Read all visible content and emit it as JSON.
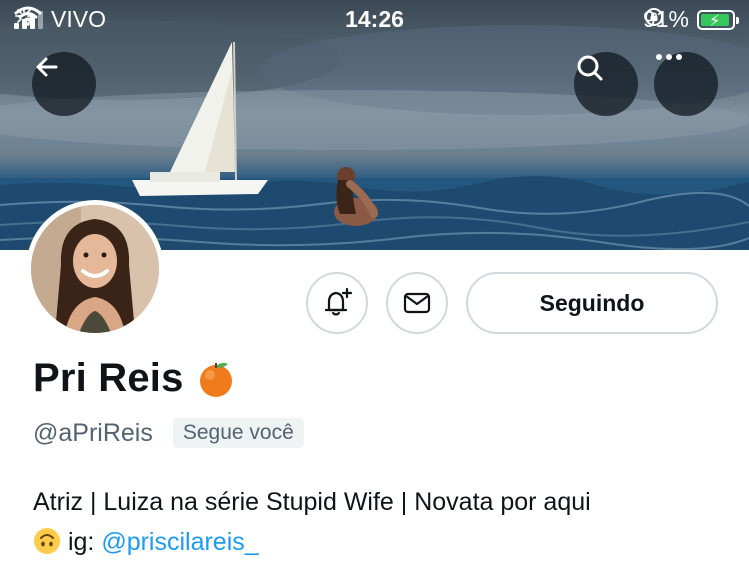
{
  "status_bar": {
    "carrier": "VIVO",
    "time": "14:26",
    "battery_percent": "91%",
    "battery_level": 0.91,
    "icons": [
      "signal-icon",
      "wifi-icon",
      "activity-icon",
      "orientation-lock-icon",
      "battery-charging-icon"
    ]
  },
  "header": {
    "back_icon": "arrow-left-icon",
    "search_icon": "search-icon",
    "more_icon": "more-horizontal-icon"
  },
  "profile": {
    "display_name": "Pri Reis",
    "name_emoji": "orange-emoji",
    "handle": "@aPriReis",
    "follows_you": "Segue você",
    "bio_text": "Atriz | Luiza na série Stupid Wife | Novata por aqui",
    "bio_emoji": "upside-down-face-emoji",
    "bio_ig_label": "ig:",
    "bio_link": "@priscilareis_"
  },
  "actions": {
    "notify_icon": "bell-plus-icon",
    "message_icon": "mail-icon",
    "following_label": "Seguindo"
  },
  "colors": {
    "link": "#1d9bf0",
    "muted_text": "#536471",
    "border": "#cfd9de",
    "battery_fill": "#34c759"
  }
}
